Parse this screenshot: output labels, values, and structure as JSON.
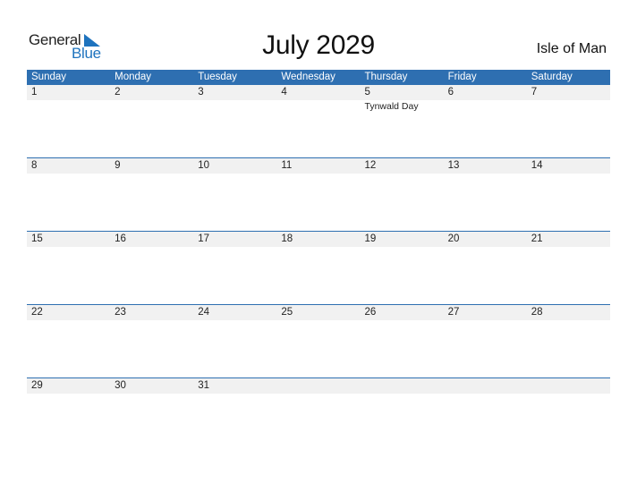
{
  "logo": {
    "word1": "General",
    "word2": "Blue"
  },
  "title": "July 2029",
  "region": "Isle of Man",
  "colors": {
    "header_bg": "#2e6fb1",
    "day_bar_bg": "#f1f1f1",
    "logo_blue": "#1e73be"
  },
  "weekdays": [
    "Sunday",
    "Monday",
    "Tuesday",
    "Wednesday",
    "Thursday",
    "Friday",
    "Saturday"
  ],
  "weeks": [
    {
      "days": [
        "1",
        "2",
        "3",
        "4",
        "5",
        "6",
        "7"
      ],
      "events": [
        "",
        "",
        "",
        "",
        "Tynwald Day",
        "",
        ""
      ]
    },
    {
      "days": [
        "8",
        "9",
        "10",
        "11",
        "12",
        "13",
        "14"
      ],
      "events": [
        "",
        "",
        "",
        "",
        "",
        "",
        ""
      ]
    },
    {
      "days": [
        "15",
        "16",
        "17",
        "18",
        "19",
        "20",
        "21"
      ],
      "events": [
        "",
        "",
        "",
        "",
        "",
        "",
        ""
      ]
    },
    {
      "days": [
        "22",
        "23",
        "24",
        "25",
        "26",
        "27",
        "28"
      ],
      "events": [
        "",
        "",
        "",
        "",
        "",
        "",
        ""
      ]
    },
    {
      "days": [
        "29",
        "30",
        "31",
        "",
        "",
        "",
        ""
      ],
      "events": [
        "",
        "",
        "",
        "",
        "",
        "",
        ""
      ]
    }
  ]
}
